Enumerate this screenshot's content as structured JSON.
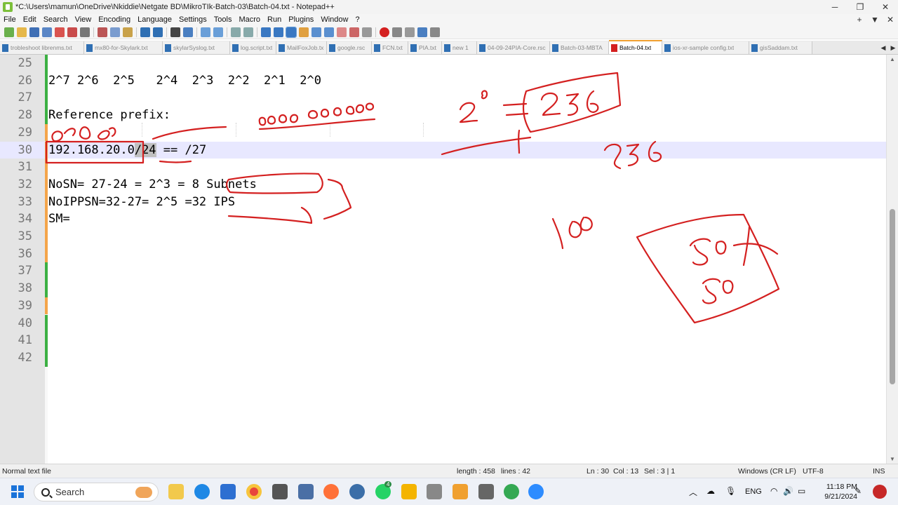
{
  "window": {
    "title": "*C:\\Users\\mamun\\OneDrive\\Nkiddie\\Netgate BD\\MikroTIk-Batch-03\\Batch-04.txt - Notepad++",
    "minimize": "─",
    "maximize": "❐",
    "close": "✕"
  },
  "menu": [
    "File",
    "Edit",
    "Search",
    "View",
    "Encoding",
    "Language",
    "Settings",
    "Tools",
    "Macro",
    "Run",
    "Plugins",
    "Window",
    "?"
  ],
  "menu_right": [
    "+",
    "▼",
    "✕"
  ],
  "tabs": [
    {
      "label": "trobleshoot librenms.txt",
      "active": false
    },
    {
      "label": "mx80-for-Skylark.txt",
      "active": false
    },
    {
      "label": "skylarSyslog.txt",
      "active": false
    },
    {
      "label": "log.script.txt",
      "active": false
    },
    {
      "label": "MailFoxJob.txt",
      "active": false
    },
    {
      "label": "google.rsc",
      "active": false
    },
    {
      "label": "FCN.txt",
      "active": false
    },
    {
      "label": "PIA.txt",
      "active": false
    },
    {
      "label": "new 1",
      "active": false
    },
    {
      "label": "04-09-24PIA-Core.rsc",
      "active": false
    },
    {
      "label": "Batch-03-MBTA",
      "active": false
    },
    {
      "label": "Batch-04.txt",
      "active": true
    },
    {
      "label": "ios-xr-sample config.txt",
      "active": false
    },
    {
      "label": "gisSaddam.txt",
      "active": false
    }
  ],
  "editor": {
    "lines": [
      {
        "num": "25",
        "text": "",
        "mark": "green"
      },
      {
        "num": "26",
        "text": "2^7 2^6  2^5   2^4  2^3  2^2  2^1  2^0",
        "mark": "green"
      },
      {
        "num": "27",
        "text": "",
        "mark": "green"
      },
      {
        "num": "28",
        "text": "Reference prefix:",
        "mark": "green"
      },
      {
        "num": "29",
        "text": "",
        "mark": "orange"
      },
      {
        "num": "30",
        "text_pre": "192.168.20.0",
        "text_sel": "/24",
        "text_post": " == /27",
        "mark": "orange",
        "current": true
      },
      {
        "num": "31",
        "text": "",
        "mark": "orange"
      },
      {
        "num": "32",
        "text": "NoSN= 27-24 = 2^3 = 8 Subnets",
        "mark": "orange"
      },
      {
        "num": "33",
        "text": "NoIPPSN=32-27= 2^5 =32 IPS",
        "mark": "orange"
      },
      {
        "num": "34",
        "text": "SM=",
        "mark": "orange"
      },
      {
        "num": "35",
        "text": "",
        "mark": "orange"
      },
      {
        "num": "36",
        "text": "",
        "mark": "orange"
      },
      {
        "num": "37",
        "text": "",
        "mark": "green"
      },
      {
        "num": "38",
        "text": "",
        "mark": "green"
      },
      {
        "num": "39",
        "text": "",
        "mark": "orange"
      },
      {
        "num": "40",
        "text": "",
        "mark": "green"
      },
      {
        "num": "41",
        "text": "",
        "mark": "green"
      },
      {
        "num": "42",
        "text": "",
        "mark": "green"
      }
    ]
  },
  "status": {
    "file_type": "Normal text file",
    "length": "length : 458",
    "lines": "lines : 42",
    "ln": "Ln : 30",
    "col": "Col : 13",
    "sel": "Sel : 3 | 1",
    "eol": "Windows (CR LF)",
    "encoding": "UTF-8",
    "mode": "INS"
  },
  "taskbar": {
    "search_label": "Search",
    "lang": "ENG",
    "time": "11:18 PM",
    "date": "9/21/2024",
    "whatsapp_badge": "4"
  },
  "colors": {
    "accent_green": "#3cb043",
    "accent_orange": "#f4a54a",
    "ink_red": "#d42020",
    "current_line": "#e8e8ff"
  }
}
